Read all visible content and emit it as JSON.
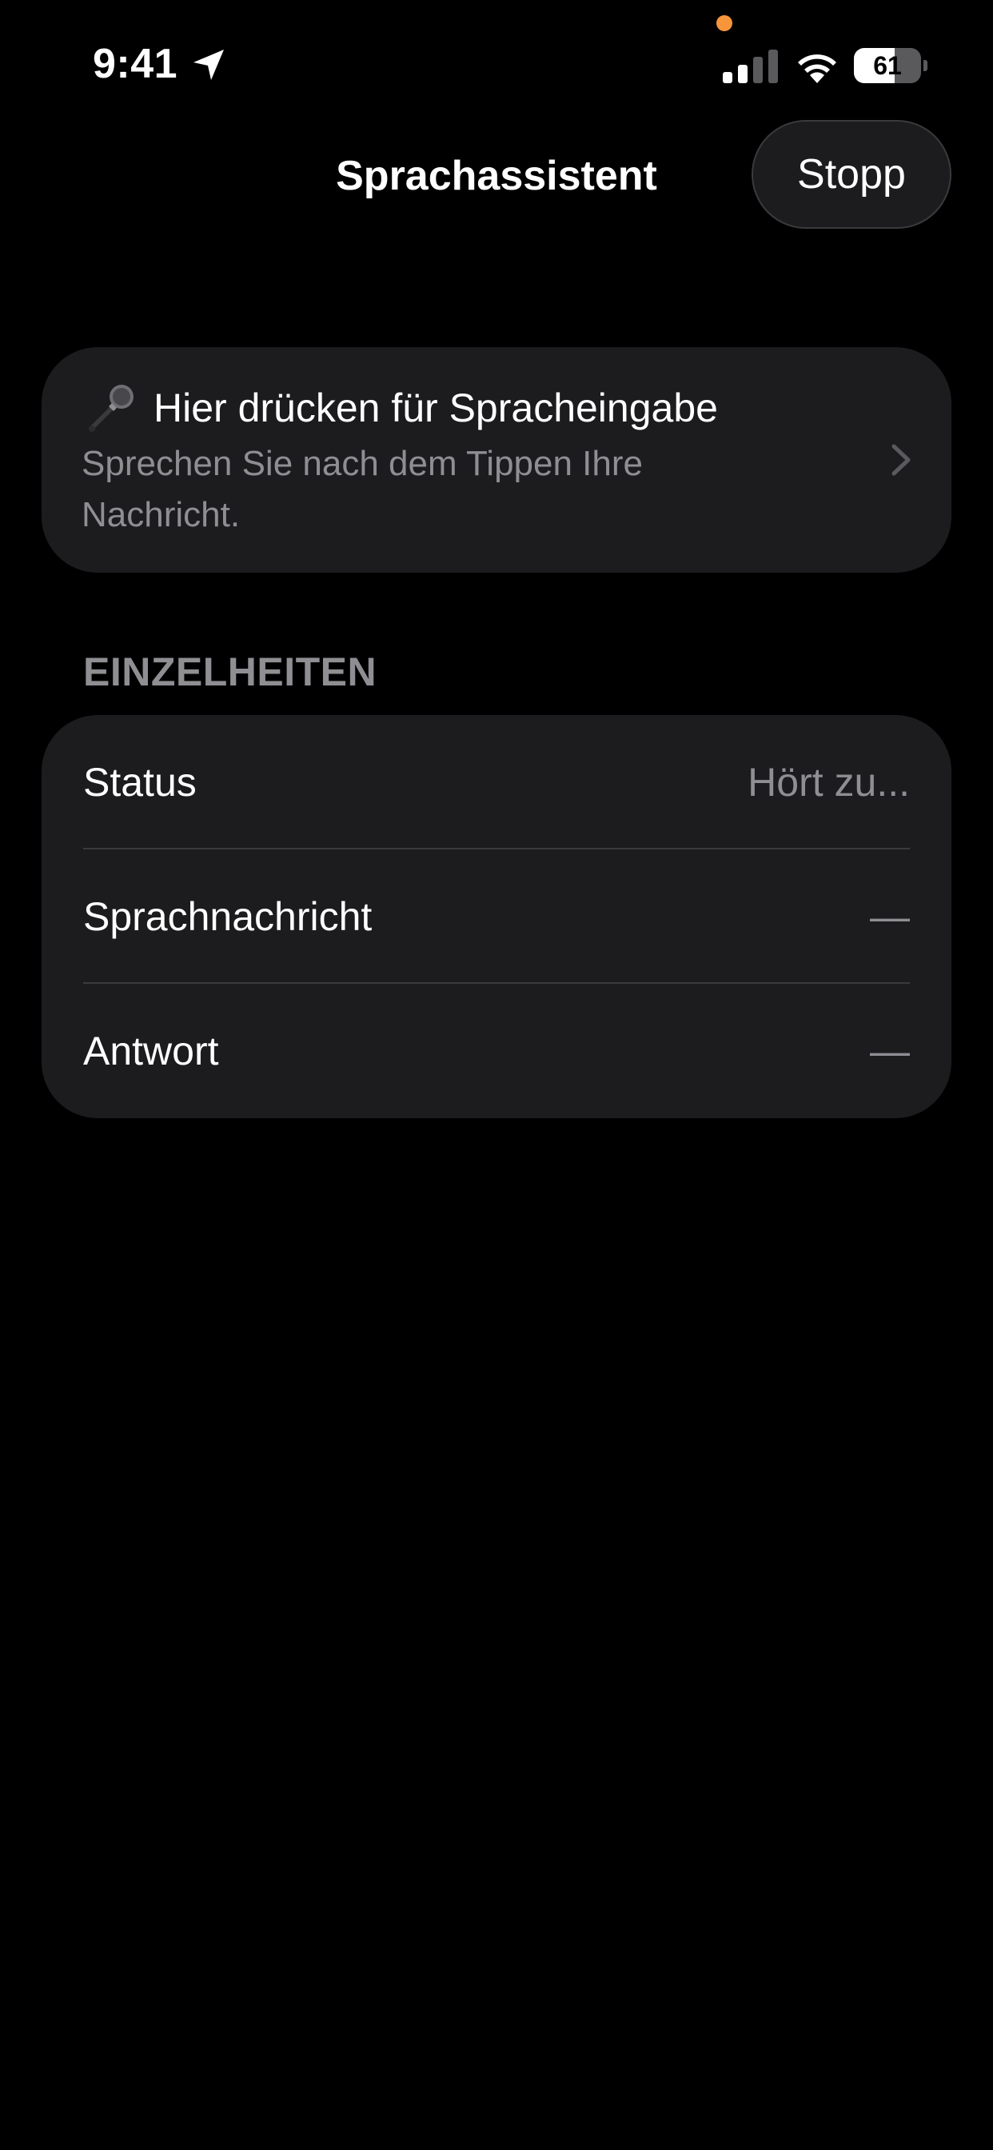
{
  "status_bar": {
    "time": "9:41",
    "battery_level": "61",
    "battery_fraction": 0.61,
    "icons": [
      "location-arrow-icon",
      "signal-icon",
      "wifi-icon",
      "battery-icon"
    ],
    "privacy_indicator_color": "#f7953b"
  },
  "nav": {
    "title": "Sprachassistent",
    "stop_label": "Stopp"
  },
  "voice_card": {
    "title": "Hier drücken für Spracheingabe",
    "subtitle": "Sprechen Sie nach dem Tippen Ihre Nachricht.",
    "icon": "microphone-icon"
  },
  "details": {
    "header": "EINZELHEITEN",
    "rows": [
      {
        "label": "Status",
        "value": "Hört zu..."
      },
      {
        "label": "Sprachnachricht",
        "value": "—"
      },
      {
        "label": "Antwort",
        "value": "—"
      }
    ]
  },
  "colors": {
    "background": "#000000",
    "card": "#1c1c1e",
    "secondary_text": "#8e8e93",
    "divider": "#3a3a3c"
  }
}
